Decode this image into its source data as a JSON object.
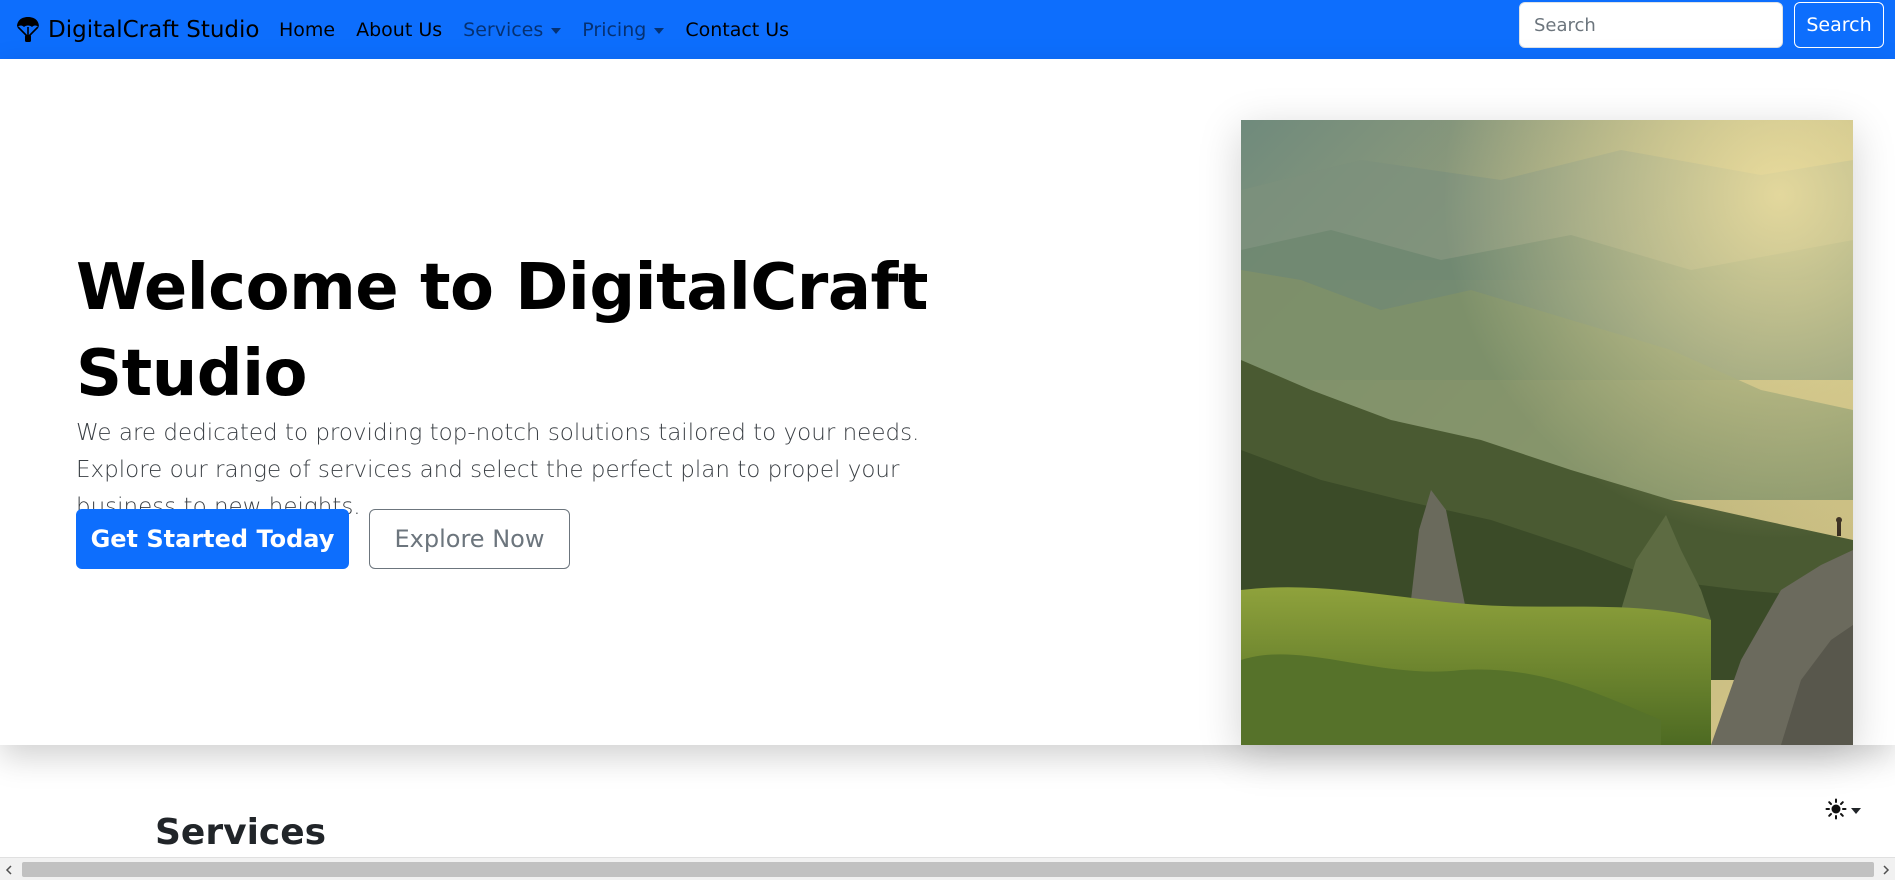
{
  "navbar": {
    "brand": "DigitalCraft Studio",
    "brand_icon": "parachute-icon",
    "links": [
      {
        "label": "Home"
      },
      {
        "label": "About Us"
      },
      {
        "label": "Services"
      },
      {
        "label": "Pricing"
      },
      {
        "label": "Contact Us"
      }
    ],
    "search": {
      "placeholder": "Search",
      "button_label": "Search"
    },
    "colors": {
      "background": "#0d6efd",
      "text": "#000000"
    }
  },
  "hero": {
    "title": "Welcome to DigitalCraft Studio",
    "text": "We are dedicated to providing top-notch solutions tailored to your needs. Explore our range of services and select the perfect plan to propel your business to new heights.",
    "primary_button": "Get Started Today",
    "secondary_button": "Explore Now",
    "image_icon": "mountain-landscape-photo"
  },
  "services": {
    "title": "Services"
  },
  "theme_toggle": {
    "icon": "sun-icon"
  },
  "scrollbar": {
    "left_icon": "chevron-left-icon",
    "right_icon": "chevron-right-icon"
  }
}
